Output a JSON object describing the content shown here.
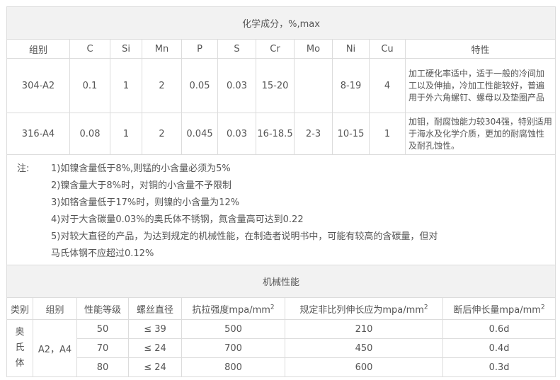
{
  "composition": {
    "title": "化学成分，%,max",
    "headers": [
      "组别",
      "C",
      "Si",
      "Mn",
      "P",
      "S",
      "Cr",
      "Mo",
      "Ni",
      "Cu",
      "特性"
    ],
    "rows": [
      [
        "304-A2",
        "0.1",
        "1",
        "2",
        "0.05",
        "0.03",
        "15-20",
        "",
        "8-19",
        "4",
        "加工硬化率适中，适于一般的冷间加工以及伸抽，冷加工性能较好，普遍用于外六角螺钉、螺母以及垫圈产品"
      ],
      [
        "316-A4",
        "0.08",
        "1",
        "2",
        "0.045",
        "0.03",
        "16-18.5",
        "2-3",
        "10-15",
        "1",
        "加钼，耐腐蚀能力较304强，特别适用于海水及化学介质，更加的耐腐蚀性及耐孔蚀性。"
      ]
    ],
    "notes_label": "注:",
    "notes": [
      "1)如镍含量低于8%,则锰的小含量必须为5%",
      "2)镍含量大于8%时，对铜的小含量不予限制",
      "3)如铬含量低于17%时，则镍的小含量为12%",
      "4)对于大含碳量0.03%的奥氏体不锈钢，氮含量高可达到0.22",
      "5)对较大直径的产品，为达到规定的机械性能，在制造者说明书中，可能有较高的含碳量，但对",
      "马氏体钢不应超过0.12%"
    ]
  },
  "mechanical": {
    "title": "机械性能",
    "headers": [
      "类别",
      "组别",
      "性能等级",
      "螺丝直径",
      "抗拉强度mpa/mm",
      "规定非比列伸长应为mpa/mm",
      "断后伸长量mpa/mm"
    ],
    "superscript": "2",
    "category": "奥氏体",
    "group": "A2，A4",
    "rows": [
      [
        "50",
        "≤ 39",
        "500",
        "210",
        "0.6d"
      ],
      [
        "70",
        "≤ 24",
        "700",
        "450",
        "0.4d"
      ],
      [
        "80",
        "≤ 24",
        "800",
        "600",
        "0.3d"
      ]
    ]
  }
}
